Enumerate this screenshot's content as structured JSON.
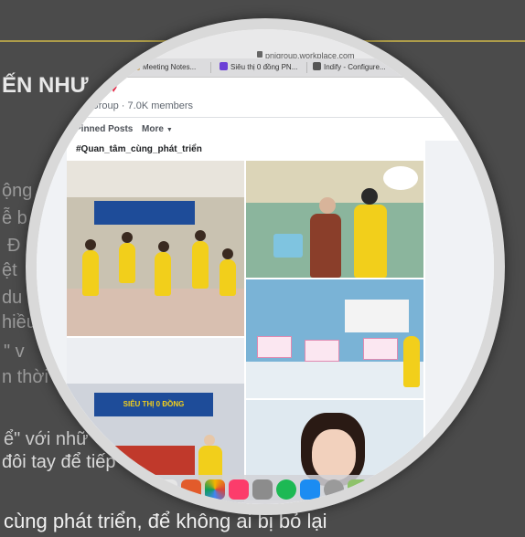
{
  "background": {
    "heading": "ẾN NHƯ",
    "lines": [
      "ộng",
      "ễ b",
      "Đ",
      "ệt",
      "du",
      "hiều",
      "\" v",
      "n thời"
    ],
    "line_4": "ể\" với nhữ",
    "line_5": "đôi tay để tiếp",
    "bottom": "cùng phát triển, để không ai bị bỏ lại"
  },
  "browser": {
    "url": "pnjgroup.workplace.com",
    "tabs": [
      {
        "label": "Meeting Notes...",
        "favicon_color": "#c8a060"
      },
      {
        "label": "Siêu thị 0 đồng PN...",
        "favicon_color": "#6b3fd6"
      },
      {
        "label": "Indify - Configure...",
        "favicon_color": "#555555"
      }
    ]
  },
  "group": {
    "name_partial": "n",
    "meta": "n Group · 7.0K members",
    "nav": {
      "pinned": "Pinned Posts",
      "more": "More"
    }
  },
  "post": {
    "hashtag": "#Quan_tâm_cùng_phát_triển",
    "photo_a_banner": "",
    "photo_d_banner": "SIÊU THỊ 0 ĐỒNG"
  },
  "colors": {
    "brand_yellow": "#f2cf1b",
    "brand_blue": "#1e4c99",
    "heart": "#e4193a"
  }
}
